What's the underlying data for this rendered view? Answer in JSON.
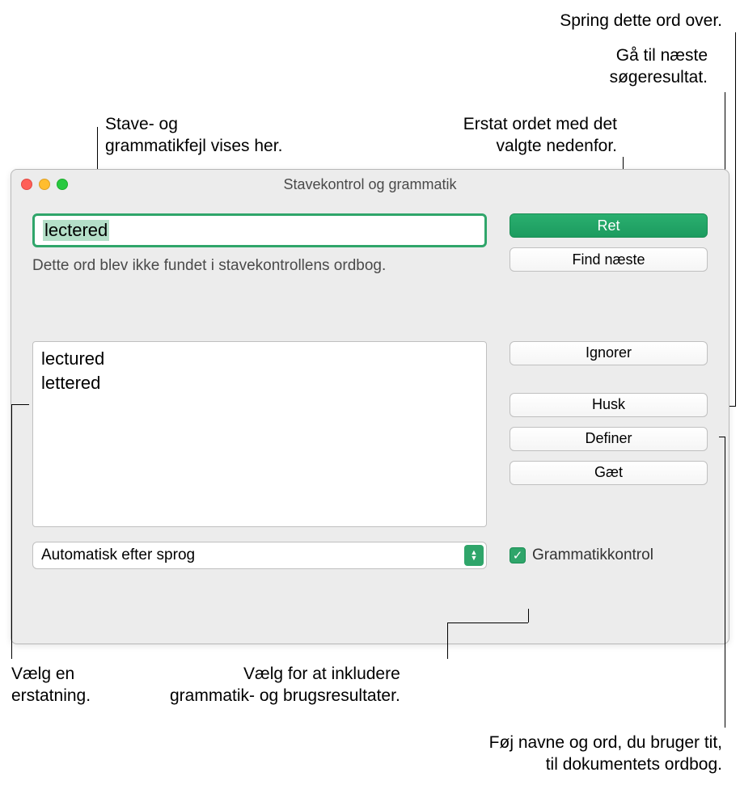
{
  "callouts": {
    "skipWord": "Spring dette ord over.",
    "nextResult1": "Gå til næste",
    "nextResult2": "søgeresultat.",
    "errorsShown1": "Stave- og",
    "errorsShown2": "grammatikfejl vises her.",
    "replaceWord1": "Erstat ordet med det",
    "replaceWord2": "valgte nedenfor.",
    "chooseReplace1": "Vælg en",
    "chooseReplace2": "erstatning.",
    "includeGrammar1": "Vælg for at inkludere",
    "includeGrammar2": "grammatik- og brugsresultater.",
    "addNames1": "Føj navne og ord, du bruger tit,",
    "addNames2": "til dokumentets ordbog."
  },
  "window": {
    "title": "Stavekontrol og grammatik"
  },
  "input": {
    "word": "lectered"
  },
  "status": "Dette ord blev ikke fundet i stavekontrollens ordbog.",
  "buttons": {
    "ret": "Ret",
    "findNext": "Find næste",
    "ignore": "Ignorer",
    "remember": "Husk",
    "define": "Definer",
    "guess": "Gæt"
  },
  "suggestions": {
    "item0": "lectured",
    "item1": "lettered"
  },
  "dropdown": {
    "selected": "Automatisk efter sprog"
  },
  "checkbox": {
    "label": "Grammatikkontrol"
  }
}
